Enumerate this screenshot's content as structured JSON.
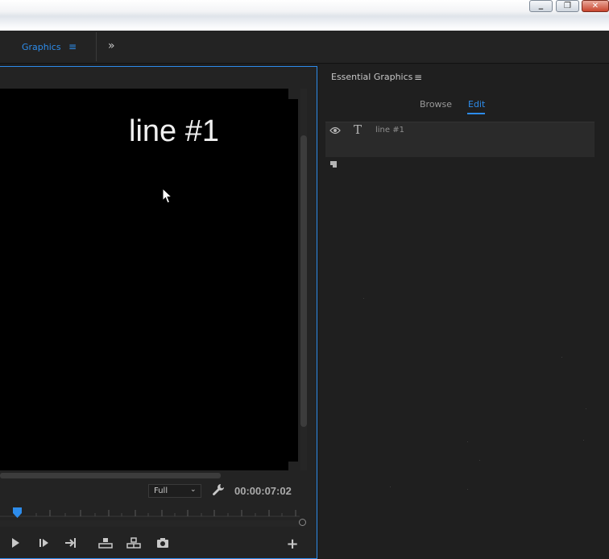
{
  "window": {
    "minimize_glyph": "▁",
    "restore_glyph": "❐",
    "close_glyph": "✕"
  },
  "header": {
    "active_tab": "Graphics",
    "tab_menu_glyph": "≡",
    "overflow_glyph": "»"
  },
  "monitor": {
    "overlay_text": "line #1",
    "resolution": "Full",
    "timecode": "00:00:07:02",
    "controls": [
      "play-icon",
      "step-forward-icon",
      "go-to-out-icon",
      "lift-icon",
      "extract-icon",
      "export-frame-icon",
      "add-button-icon"
    ],
    "add_glyph": "+"
  },
  "essential_graphics": {
    "title": "Essential Graphics",
    "menu_glyph": "≡",
    "tabs": [
      "Browse",
      "Edit"
    ],
    "active_tab": "Edit",
    "layer": {
      "type_glyph": "T",
      "name": "line #1",
      "visible": true
    }
  },
  "colors": {
    "accent": "#2d8ceb",
    "panel_bg": "#1f1f1f",
    "video_bg": "#000000"
  }
}
